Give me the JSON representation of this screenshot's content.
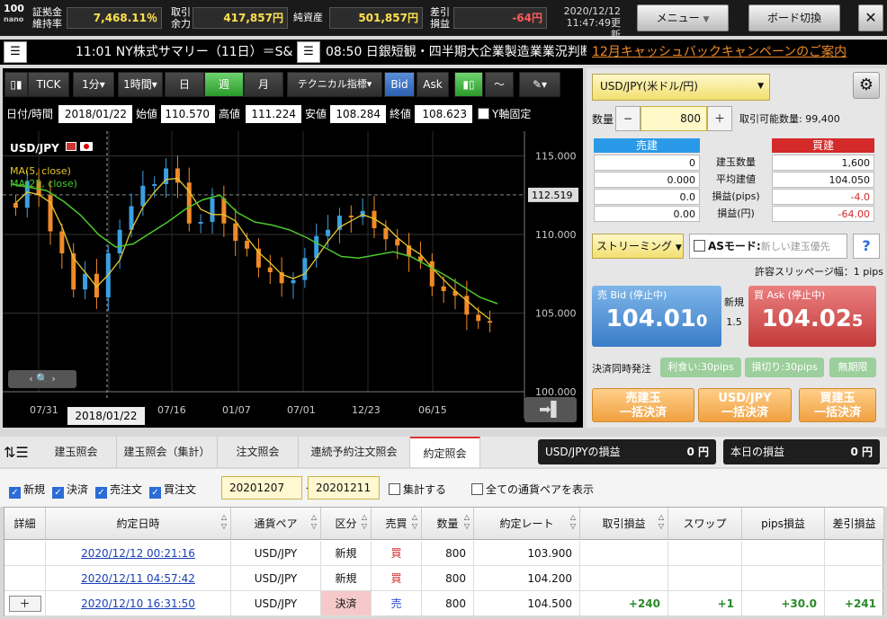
{
  "topbar": {
    "logo_top": "100",
    "logo_bottom": "nano",
    "margin_ratio_label": "証拠金\n維持率",
    "margin_ratio_value": "7,468.11％",
    "available_label": "取引\n余力",
    "available_value": "417,857円",
    "net_assets_label": "純資産",
    "net_assets_value": "501,857円",
    "pl_label": "差引\n損益",
    "pl_value": "-64円",
    "date": "2020/12/12",
    "updated": "11:47:49更新",
    "menu_label": "メニュー",
    "menu_arrow": "▼",
    "board_switch_label": "ボード切換",
    "close": "✕"
  },
  "news": {
    "item1": "11:01 NY株式サマリー（11日）＝S&",
    "item2": "08:50 日銀短観・四半期大企業製造業業況判断",
    "campaign": "12月キャッシュバックキャンペーンのご案内"
  },
  "chart": {
    "toolbar": {
      "tick": "TICK",
      "min1": "1分",
      "hour1": "1時間",
      "day": "日",
      "week": "週",
      "month": "月",
      "technical": "テクニカル指標",
      "bid": "Bid",
      "ask": "Ask",
      "arrow": "▾"
    },
    "ohlc": {
      "date_label": "日付/時間",
      "date": "2018/01/22",
      "open_label": "始値",
      "open": "110.570",
      "high_label": "高値",
      "high": "111.224",
      "low_label": "安値",
      "low": "108.284",
      "close_label": "終値",
      "close": "108.623",
      "yfix_label": "Y軸固定"
    },
    "pair": "USD/JPY",
    "legend": [
      "MA(5, close)",
      "MA(25, close)"
    ],
    "yticks": [
      "115.000",
      "110.000",
      "105.000",
      "100.000"
    ],
    "current_price": "112.519",
    "xticks": [
      "07/31",
      "07/16",
      "01/07",
      "07/01",
      "12/23",
      "06/15"
    ],
    "crosshair_label": "2018/01/22",
    "colors": {
      "up": "#3aa0e0",
      "down": "#f08a28",
      "ma5": "#e6c82e",
      "ma25": "#4cc82e"
    }
  },
  "chart_data": {
    "type": "line",
    "title": "USD/JPY",
    "ylim": [
      100,
      116
    ],
    "series": [
      {
        "name": "MA(25, close)",
        "values": [
          113.2,
          113.0,
          112.8,
          112.1,
          111.2,
          110.0,
          109.2,
          109.4,
          110.1,
          110.8,
          111.6,
          112.2,
          112.5,
          111.4,
          110.8,
          110.6,
          110.3,
          109.8,
          109.2,
          108.6,
          108.5,
          108.7,
          108.9,
          108.6,
          108.0,
          107.4,
          106.7,
          106.0,
          105.6
        ]
      }
    ]
  },
  "order": {
    "pair": "USD/JPY(米ドル/円)",
    "qty_label": "数量",
    "qty": "800",
    "minus": "−",
    "plus": "＋",
    "tradable": "取引可能数量: 99,400",
    "sell_header": "売建",
    "buy_header": "買建",
    "rows": [
      {
        "label": "建玉数量",
        "sell": "0",
        "buy": "1,600"
      },
      {
        "label": "平均建値",
        "sell": "0.000",
        "buy": "104.050"
      },
      {
        "label": "損益(pips)",
        "sell": "0.0",
        "buy": "-4.0"
      },
      {
        "label": "損益(円)",
        "sell": "0.00",
        "buy": "-64.00"
      }
    ],
    "streaming": "ストリーミング",
    "as_mode": "ASモード:",
    "as_placeholder": "新しい建玉優先",
    "help": "?",
    "slippage": "許容スリッページ幅：1 pips",
    "bid_label": "売 Bid (停止中)",
    "bid_main": "104.01",
    "bid_sub": "0",
    "spread_label": "新規",
    "spread": "1.5",
    "ask_label": "買 Ask (停止中)",
    "ask_main": "104.02",
    "ask_sub": "5",
    "settle_label": "決済同時発注",
    "takeprofit": "利食い:30pips",
    "stoploss": "損切り:30pips",
    "nolimit": "無期限",
    "close_sell": "売建玉\n一括決済",
    "close_pair": "USD/JPY\n一括決済",
    "close_buy": "買建玉\n一括決済"
  },
  "tabs": {
    "items": [
      "建玉照会",
      "建玉照会（集計）",
      "注文照会",
      "連続予約注文照会",
      "約定照会"
    ],
    "pair_pl_label": "USD/JPYの損益",
    "pair_pl": "0 円",
    "day_pl_label": "本日の損益",
    "day_pl": "0 円"
  },
  "filter": {
    "new": "新規",
    "settle": "決済",
    "sell": "売注文",
    "buy": "買注文",
    "from": "20201207",
    "tilde": "～",
    "to": "20201211",
    "aggregate": "集計する",
    "allpairs": "全ての通貨ペアを表示"
  },
  "table": {
    "headers": [
      "詳細",
      "約定日時",
      "通貨ペア",
      "区分",
      "売買",
      "数量",
      "約定レート",
      "取引損益",
      "スワップ",
      "pips損益",
      "差引損益"
    ],
    "rows": [
      {
        "detail": "",
        "time": "2020/12/12 00:21:16",
        "pair": "USD/JPY",
        "kind": "新規",
        "side": "買",
        "qty": "800",
        "rate": "103.900",
        "pl": "",
        "swap": "",
        "pips": "",
        "net": ""
      },
      {
        "detail": "",
        "time": "2020/12/11 04:57:42",
        "pair": "USD/JPY",
        "kind": "新規",
        "side": "買",
        "qty": "800",
        "rate": "104.200",
        "pl": "",
        "swap": "",
        "pips": "",
        "net": ""
      },
      {
        "detail": "＋",
        "time": "2020/12/10 16:31:50",
        "pair": "USD/JPY",
        "kind": "決済",
        "side": "売",
        "qty": "800",
        "rate": "104.500",
        "pl": "+240",
        "swap": "+1",
        "pips": "+30.0",
        "net": "+241"
      }
    ]
  }
}
